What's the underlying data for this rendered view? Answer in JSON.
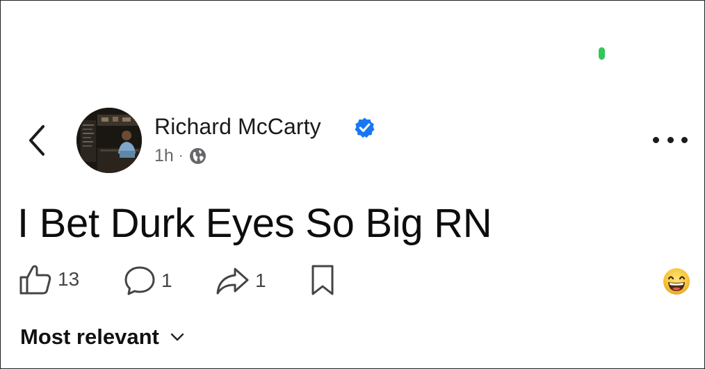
{
  "post": {
    "author": {
      "name": "Richard McCarty",
      "verified": true,
      "timestamp": "1h",
      "meta_separator": "·",
      "audience_icon": "globe-icon"
    },
    "text": "I Bet Durk Eyes So Big RN",
    "actions": {
      "likes": "13",
      "comments": "1",
      "shares": "1"
    },
    "reaction_emoji": "laughing-face-icon"
  },
  "comments": {
    "sort_label": "Most relevant"
  },
  "colors": {
    "verified_badge": "#1877f2",
    "status_dot": "#34c759",
    "meta_text": "#65676b"
  }
}
